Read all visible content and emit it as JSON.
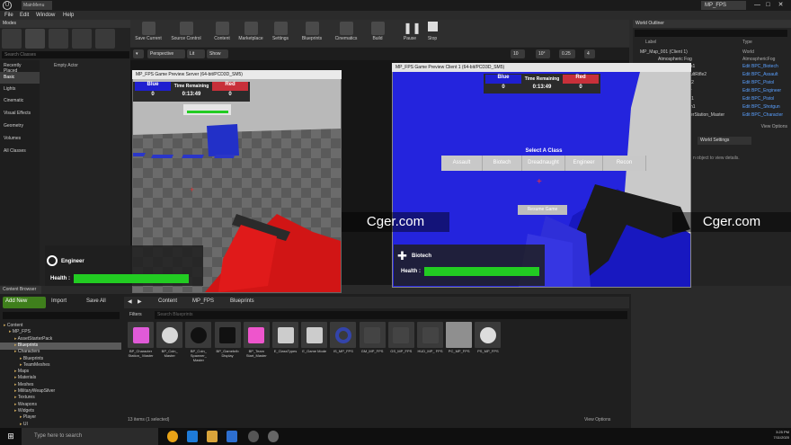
{
  "window": {
    "tab_label": "MainMenu",
    "title": "MP_FPS",
    "minimize": "—",
    "maximize": "□",
    "close": "✕"
  },
  "menu": [
    "File",
    "Edit",
    "Window",
    "Help"
  ],
  "modes": {
    "title": "Modes",
    "search_placeholder": "Search Classes",
    "categories": [
      "Recently Placed",
      "Basic",
      "Lights",
      "Cinematic",
      "Visual Effects",
      "Geometry",
      "Volumes",
      "All Classes"
    ],
    "active_category": "Basic",
    "first_item": "Empty Actor"
  },
  "toolbar": [
    {
      "label": "Save Current",
      "icon": "save-icon"
    },
    {
      "label": "Source Control",
      "icon": "source-control-icon"
    },
    {
      "label": "Content",
      "icon": "content-icon"
    },
    {
      "label": "Marketplace",
      "icon": "marketplace-icon"
    },
    {
      "label": "Settings",
      "icon": "gear-icon"
    },
    {
      "label": "Blueprints",
      "icon": "blueprint-icon"
    },
    {
      "label": "Cinematics",
      "icon": "cinematics-icon"
    },
    {
      "label": "Build",
      "icon": "build-icon"
    },
    {
      "label": "Pause",
      "icon": "pause-icon"
    },
    {
      "label": "Stop",
      "icon": "stop-icon"
    }
  ],
  "viewport_bar": {
    "perspective": "Perspective",
    "lit": "Lit",
    "show": "Show",
    "grid_snap": "10",
    "rot_snap": "10°",
    "scale_snap": "0.25",
    "camera_speed": "4"
  },
  "outliner": {
    "title": "World Outliner",
    "columns": {
      "label": "Label",
      "type": "Type"
    },
    "rows": [
      {
        "label": "MP_Map_001 (Client 1)",
        "type": "World"
      },
      {
        "label": "Atmospheric Fog",
        "type": "AtmosphericFog"
      },
      {
        "label": "s1",
        "type": "Edit BPC_Biotech"
      },
      {
        "label": "ultRifle2",
        "type": "Edit BPC_Assault"
      },
      {
        "label": "l2",
        "type": "Edit BPC_Pistol"
      },
      {
        "label": "r",
        "type": "Edit BPC_Engineer"
      },
      {
        "label": "l1",
        "type": "Edit BPC_Pistol"
      },
      {
        "label": "n1",
        "type": "Edit BPC_Shotgun"
      },
      {
        "label": "erStation_Master",
        "type": "Edit BPC_Character"
      }
    ],
    "footer": "View Options"
  },
  "details": {
    "tab": "World Settings",
    "hint": "n object to view details."
  },
  "server_window": {
    "title": "MP_FPS Game Preview Server (64-bit/PCD3D_SM5)",
    "hud": {
      "blue": "Blue",
      "time_label": "Time Remaining",
      "red": "Red",
      "blue_score": "0",
      "time": "0:13:49",
      "red_score": "0"
    },
    "player_class": "Engineer",
    "health_label": "Health :",
    "health_fraction": 1.0
  },
  "client_window": {
    "title": "MP_FPS Game Preview Client 1 (64-bit/PCD3D_SM5)",
    "hud": {
      "blue": "Blue",
      "time_label": "Time Remaining",
      "red": "Red",
      "blue_score": "0",
      "time": "0:13:49",
      "red_score": "0"
    },
    "select_title": "Select A Class",
    "classes": [
      "Assault",
      "Biotech",
      "Dreadnaught",
      "Engineer",
      "Recon"
    ],
    "resume": "Resume Game",
    "player_class": "Biotech",
    "health_label": "Health :",
    "health_fraction": 1.0
  },
  "watermark": "Cger.com",
  "content_browser": {
    "tab": "Content Browser",
    "add_new": "Add New",
    "import": "Import",
    "save_all": "Save All",
    "breadcrumb": [
      "Content",
      "MP_FPS",
      "Blueprints"
    ],
    "filters": "Filters",
    "search_placeholder": "Search Blueprints",
    "tree": [
      {
        "label": "Content",
        "indent": 0
      },
      {
        "label": "MP_FPS",
        "indent": 1
      },
      {
        "label": "AssetStarterPack",
        "indent": 2
      },
      {
        "label": "Blueprints",
        "indent": 2,
        "selected": true
      },
      {
        "label": "Characters",
        "indent": 2
      },
      {
        "label": "Blueprints",
        "indent": 3
      },
      {
        "label": "TeamMeshes",
        "indent": 3
      },
      {
        "label": "Maps",
        "indent": 2
      },
      {
        "label": "Materials",
        "indent": 2
      },
      {
        "label": "Meshes",
        "indent": 2
      },
      {
        "label": "MilitaryWeapSilver",
        "indent": 2
      },
      {
        "label": "Textures",
        "indent": 2
      },
      {
        "label": "Weapons",
        "indent": 2
      },
      {
        "label": "Widgets",
        "indent": 2
      },
      {
        "label": "Player",
        "indent": 3
      },
      {
        "label": "UI",
        "indent": 3
      }
    ],
    "assets": [
      {
        "label": "BP_Character Station_ Master",
        "color": "#e05ad8",
        "icon": "character-station-icon"
      },
      {
        "label": "BP_Coin_ Master",
        "color": "#d8d8d8",
        "icon": "coin-icon"
      },
      {
        "label": "BP_Coin_ Spawner_ Master",
        "color": "#111111",
        "icon": "sphere-icon"
      },
      {
        "label": "BP_Gamebrib Display",
        "color": "#111111",
        "icon": "display-icon"
      },
      {
        "label": "BP_Team Start_Master",
        "color": "#ee55cc",
        "icon": "team-start-icon"
      },
      {
        "label": "E_ClassTypes",
        "color": "#cccccc",
        "icon": "enum-icon"
      },
      {
        "label": "E_Game Mode",
        "color": "#cccccc",
        "icon": "enum-icon"
      },
      {
        "label": "IS_MP_FPS",
        "color": "#3344aa",
        "icon": "ring-icon"
      },
      {
        "label": "GM_MP_FPS",
        "color": "#444444",
        "icon": "gamemode-icon"
      },
      {
        "label": "GS_MP_FPS",
        "color": "#444444",
        "icon": "gamestate-icon"
      },
      {
        "label": "HUD_MP_ FPS",
        "color": "#444444",
        "icon": "hud-icon"
      },
      {
        "label": "PC_MP_FPS",
        "color": "#8f8f8f",
        "icon": "controller-icon",
        "selected": true
      },
      {
        "label": "PS_MP_FPS",
        "color": "#dddddd",
        "icon": "playerstate-icon"
      }
    ],
    "items_count": "13 items (1 selected)",
    "view_options": "View Options"
  },
  "taskbar": {
    "search_placeholder": "Type here to search",
    "time": "3:25 PM",
    "date": "7/11/2020"
  },
  "colors": {
    "blue_team": "#1f1fd0",
    "red_team": "#c8303a",
    "health": "#22cc22",
    "hud_panel": "#2b2b2b"
  }
}
